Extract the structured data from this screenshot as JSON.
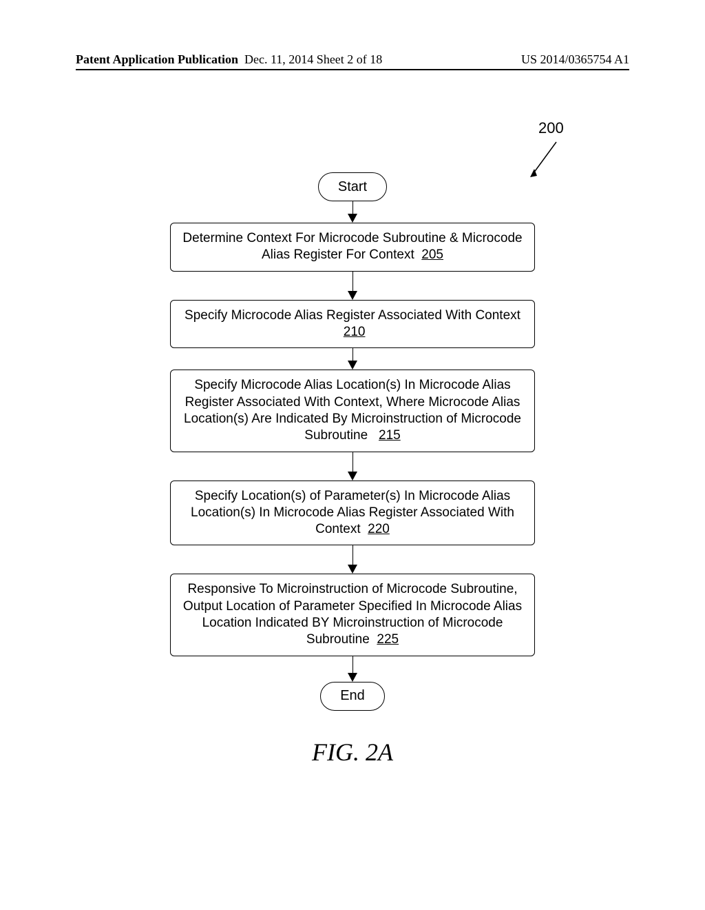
{
  "header": {
    "left": "Patent Application Publication",
    "mid": "Dec. 11, 2014  Sheet 2 of 18",
    "right": "US 2014/0365754 A1"
  },
  "figure_number_label": "200",
  "terminators": {
    "start": "Start",
    "end": "End"
  },
  "steps": [
    {
      "text": "Determine Context For Microcode Subroutine & Microcode Alias Register For Context",
      "ref": "205"
    },
    {
      "text": "Specify Microcode Alias Register Associated With Context",
      "ref": "210"
    },
    {
      "text": "Specify Microcode Alias Location(s) In Microcode Alias Register Associated With Context, Where Microcode Alias Location(s) Are Indicated By Microinstruction of Microcode Subroutine",
      "ref": "215"
    },
    {
      "text": "Specify Location(s) of Parameter(s) In Microcode Alias Location(s) In Microcode Alias Register Associated With Context",
      "ref": "220"
    },
    {
      "text": "Responsive To Microinstruction of Microcode Subroutine, Output Location of Parameter Specified In Microcode Alias Location Indicated BY Microinstruction of Microcode Subroutine",
      "ref": "225"
    }
  ],
  "caption": "FIG. 2A"
}
